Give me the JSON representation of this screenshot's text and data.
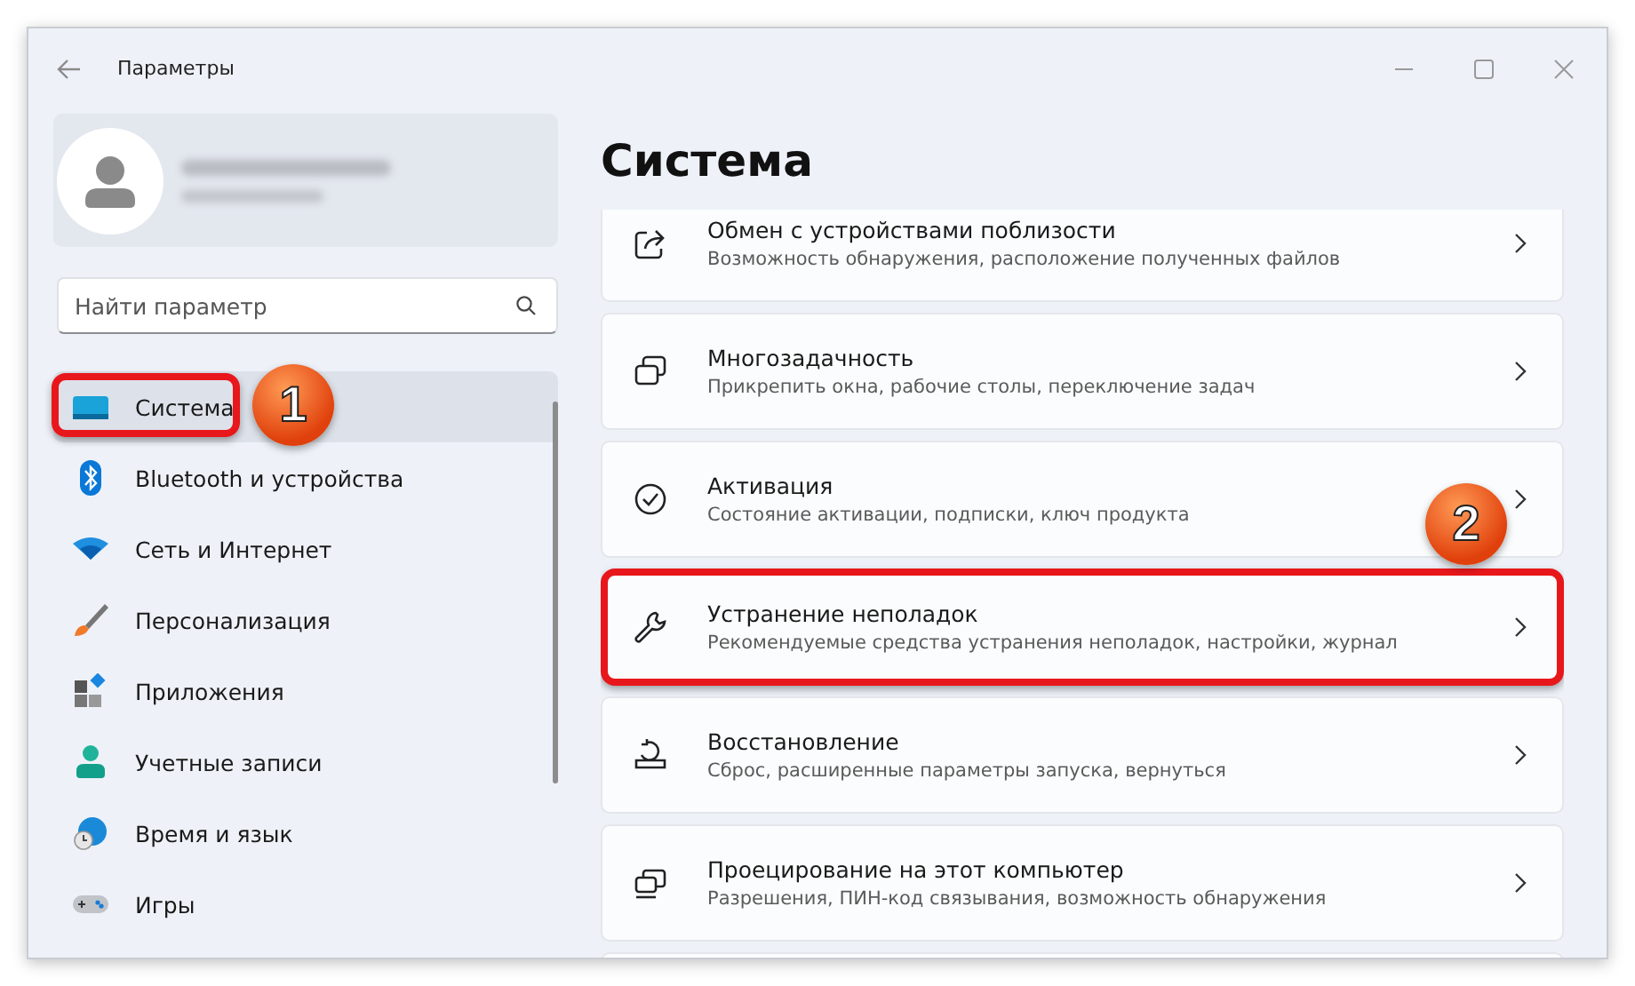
{
  "window": {
    "title": "Параметры"
  },
  "search": {
    "placeholder": "Найти параметр"
  },
  "sidebar": {
    "items": [
      {
        "label": "Система",
        "kind": "system",
        "selected": true,
        "highlighted": true,
        "badge": "1"
      },
      {
        "label": "Bluetooth и устройства",
        "kind": "bluetooth",
        "selected": false,
        "highlighted": false
      },
      {
        "label": "Сеть и Интернет",
        "kind": "wifi",
        "selected": false,
        "highlighted": false
      },
      {
        "label": "Персонализация",
        "kind": "brush",
        "selected": false,
        "highlighted": false
      },
      {
        "label": "Приложения",
        "kind": "apps",
        "selected": false,
        "highlighted": false
      },
      {
        "label": "Учетные записи",
        "kind": "person",
        "selected": false,
        "highlighted": false
      },
      {
        "label": "Время и язык",
        "kind": "globe",
        "selected": false,
        "highlighted": false
      },
      {
        "label": "Игры",
        "kind": "gamepad",
        "selected": false,
        "highlighted": false
      }
    ]
  },
  "page": {
    "title": "Система"
  },
  "settings": [
    {
      "title": "Обмен с устройствами поблизости",
      "subtitle": "Возможность обнаружения, расположение полученных файлов",
      "kind": "share",
      "highlighted": false
    },
    {
      "title": "Многозадачность",
      "subtitle": "Прикрепить окна, рабочие столы, переключение задач",
      "kind": "windows",
      "highlighted": false
    },
    {
      "title": "Активация",
      "subtitle": "Состояние активации, подписки, ключ продукта",
      "kind": "check",
      "highlighted": false
    },
    {
      "title": "Устранение неполадок",
      "subtitle": "Рекомендуемые средства устранения неполадок, настройки, журнал",
      "kind": "wrench",
      "highlighted": true,
      "badge": "2"
    },
    {
      "title": "Восстановление",
      "subtitle": "Сброс, расширенные параметры запуска, вернуться",
      "kind": "recovery",
      "highlighted": false
    },
    {
      "title": "Проецирование на этот компьютер",
      "subtitle": "Разрешения, ПИН-код связывания, возможность обнаружения",
      "kind": "project",
      "highlighted": false
    }
  ]
}
